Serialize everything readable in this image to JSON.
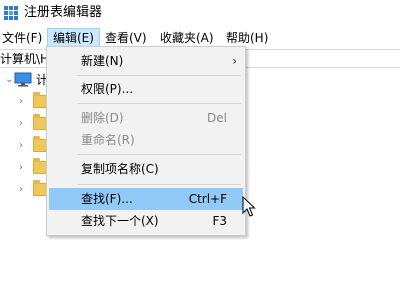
{
  "window": {
    "title": "注册表编辑器",
    "icon": "registry-editor-icon"
  },
  "menubar": {
    "items": [
      {
        "label": "文件(F)"
      },
      {
        "label": "编辑(E)",
        "active": true
      },
      {
        "label": "查看(V)"
      },
      {
        "label": "收藏夹(A)"
      },
      {
        "label": "帮助(H)"
      }
    ]
  },
  "address": {
    "path": "计算机\\H"
  },
  "tree": {
    "root_label": "计",
    "root_icon": "computer-icon",
    "folder_count_visible": 5,
    "folder_color": "#f0c85a"
  },
  "edit_menu": {
    "items": [
      {
        "label": "新建(N)",
        "submenu": true
      },
      {
        "label": "权限(P)..."
      },
      {
        "label": "删除(D)",
        "shortcut": "Del",
        "disabled": true
      },
      {
        "label": "重命名(R)",
        "disabled": true
      },
      {
        "label": "复制项名称(C)"
      },
      {
        "label": "查找(F)...",
        "shortcut": "Ctrl+F",
        "highlighted": true
      },
      {
        "label": "查找下一个(X)",
        "shortcut": "F3"
      }
    ],
    "highlight_color": "#91c9f7",
    "background_color": "#f2f2f2"
  }
}
